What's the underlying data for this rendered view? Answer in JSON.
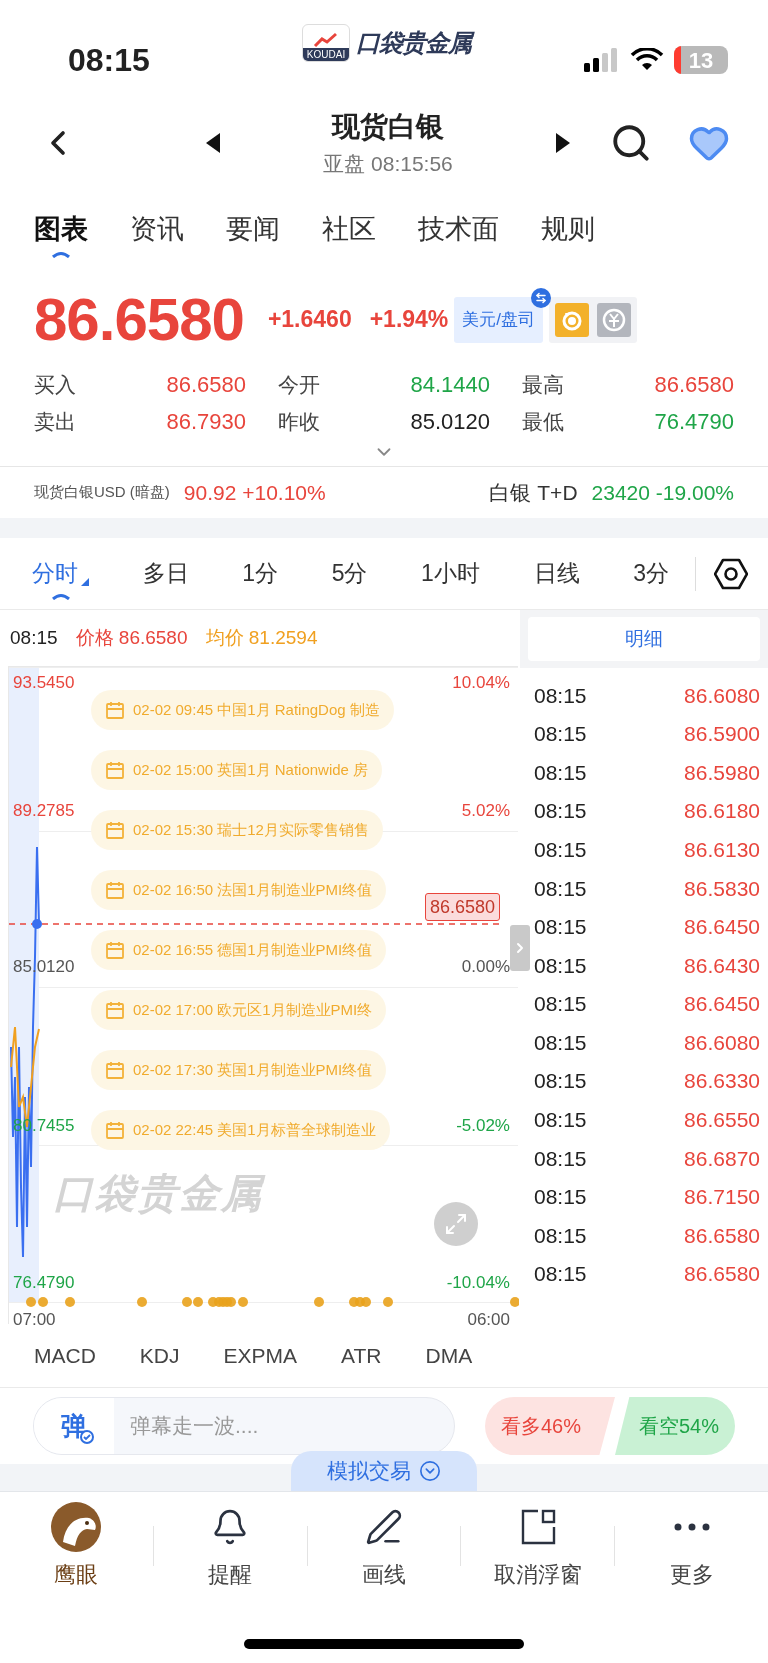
{
  "status_bar": {
    "time": "08:15",
    "battery": "13"
  },
  "logo": {
    "badge": "KOUDAI",
    "text": "口袋贵金属"
  },
  "header": {
    "title": "现货白银",
    "subtitle": "亚盘 08:15:56"
  },
  "tabs": [
    {
      "label": "图表",
      "selected": true
    },
    {
      "label": "资讯",
      "selected": false
    },
    {
      "label": "要闻",
      "selected": false
    },
    {
      "label": "社区",
      "selected": false
    },
    {
      "label": "技术面",
      "selected": false
    },
    {
      "label": "规则",
      "selected": false
    }
  ],
  "quote": {
    "price": "86.6580",
    "change": "+1.6460",
    "change_pct": "+1.94%",
    "currency_button": "美元/盘司",
    "stats": [
      {
        "label": "买入",
        "value": "86.6580",
        "color": "#e8453c"
      },
      {
        "label": "今开",
        "value": "84.1440",
        "color": "#1fa548"
      },
      {
        "label": "最高",
        "value": "86.6580",
        "color": "#e8453c"
      },
      {
        "label": "卖出",
        "value": "86.7930",
        "color": "#e8453c"
      },
      {
        "label": "昨收",
        "value": "85.0120",
        "color": "#222222"
      },
      {
        "label": "最低",
        "value": "76.4790",
        "color": "#1fa548"
      }
    ]
  },
  "related": [
    {
      "name": "现货白银USD (暗盘)",
      "value": "90.92 +10.10%",
      "color": "#e8453c"
    },
    {
      "name": "白银 T+D",
      "value": "23420 -19.00%",
      "color": "#1fa548"
    }
  ],
  "periods": [
    {
      "label": "分时",
      "selected": true
    },
    {
      "label": "多日",
      "selected": false
    },
    {
      "label": "1分",
      "selected": false
    },
    {
      "label": "5分",
      "selected": false
    },
    {
      "label": "1小时",
      "selected": false
    },
    {
      "label": "日线",
      "selected": false
    },
    {
      "label": "3分",
      "selected": false
    }
  ],
  "chart": {
    "time": "08:15",
    "price_label": "价格 86.6580",
    "avg_label": "均价 81.2594",
    "y_left": [
      {
        "label": "93.5450",
        "color": "#e8453c"
      },
      {
        "label": "89.2785",
        "color": "#e8453c"
      },
      {
        "label": "85.0120",
        "color": "#555555"
      },
      {
        "label": "80.7455",
        "color": "#1fa548"
      },
      {
        "label": "76.4790",
        "color": "#1fa548"
      }
    ],
    "y_right": [
      {
        "label": "10.04%",
        "color": "#e8453c"
      },
      {
        "label": "5.02%",
        "color": "#e8453c"
      },
      {
        "label": "0.00%",
        "color": "#555555"
      },
      {
        "label": "-5.02%",
        "color": "#1fa548"
      },
      {
        "label": "-10.04%",
        "color": "#1fa548"
      }
    ],
    "x_labels": [
      "07:00",
      "06:00"
    ],
    "current_tag": "86.6580",
    "watermark": "口袋贵金属",
    "events": [
      "02-02 09:45 中国1月 RatingDog 制造",
      "02-02 15:00 英国1月 Nationwide 房",
      "02-02 15:30 瑞士12月实际零售销售",
      "02-02 16:50 法国1月制造业PMI终值",
      "02-02 16:55 德国1月制造业PMI终值",
      "02-02 17:00 欧元区1月制造业PMI终",
      "02-02 17:30 英国1月制造业PMI终值",
      "02-02 22:45 美国1月标普全球制造业"
    ]
  },
  "detail": {
    "title": "明细",
    "rows": [
      {
        "time": "08:15",
        "price": "86.6080"
      },
      {
        "time": "08:15",
        "price": "86.5900"
      },
      {
        "time": "08:15",
        "price": "86.5980"
      },
      {
        "time": "08:15",
        "price": "86.6180"
      },
      {
        "time": "08:15",
        "price": "86.6130"
      },
      {
        "time": "08:15",
        "price": "86.5830"
      },
      {
        "time": "08:15",
        "price": "86.6450"
      },
      {
        "time": "08:15",
        "price": "86.6430"
      },
      {
        "time": "08:15",
        "price": "86.6450"
      },
      {
        "time": "08:15",
        "price": "86.6080"
      },
      {
        "time": "08:15",
        "price": "86.6330"
      },
      {
        "time": "08:15",
        "price": "86.6550"
      },
      {
        "time": "08:15",
        "price": "86.6870"
      },
      {
        "time": "08:15",
        "price": "86.7150"
      },
      {
        "time": "08:15",
        "price": "86.6580"
      },
      {
        "time": "08:15",
        "price": "86.6580"
      }
    ]
  },
  "indicators": [
    "MACD",
    "KDJ",
    "EXPMA",
    "ATR",
    "DMA"
  ],
  "comment": {
    "badge": "弹",
    "placeholder": "弹幕走一波...."
  },
  "sentiment": {
    "bull": "看多46%",
    "bear": "看空54%"
  },
  "sim_trade": "模拟交易",
  "bottom_nav": [
    {
      "label": "鹰眼",
      "kind": "eagle"
    },
    {
      "label": "提醒",
      "kind": "bell"
    },
    {
      "label": "画线",
      "kind": "pen"
    },
    {
      "label": "取消浮窗",
      "kind": "window"
    },
    {
      "label": "更多",
      "kind": "more"
    }
  ]
}
